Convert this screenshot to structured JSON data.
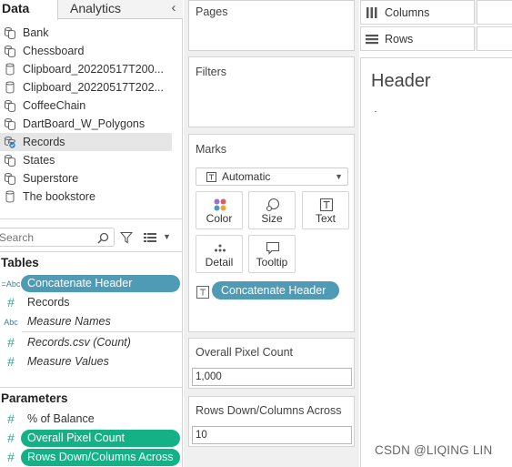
{
  "tabs": {
    "data": "Data",
    "analytics": "Analytics"
  },
  "datasources": [
    {
      "name": "Bank",
      "icon": "datasource-multi-icon"
    },
    {
      "name": "Chessboard",
      "icon": "datasource-multi-icon"
    },
    {
      "name": "Clipboard_20220517T200...",
      "icon": "datasource-cylinder-icon"
    },
    {
      "name": "Clipboard_20220517T202...",
      "icon": "datasource-cylinder-icon"
    },
    {
      "name": "CoffeeChain",
      "icon": "datasource-multi-icon"
    },
    {
      "name": "DartBoard_W_Polygons",
      "icon": "datasource-multi-icon"
    },
    {
      "name": "Records",
      "icon": "datasource-active-icon",
      "selected": true
    },
    {
      "name": "States",
      "icon": "datasource-multi-icon"
    },
    {
      "name": "Superstore",
      "icon": "datasource-multi-icon"
    },
    {
      "name": "The bookstore",
      "icon": "datasource-cylinder-icon"
    }
  ],
  "search": {
    "placeholder": "Search"
  },
  "tables": {
    "header": "Tables",
    "fields": [
      {
        "type": "=Abc",
        "name": "Concatenate Header",
        "pill": "blue"
      },
      {
        "type": "#",
        "name": "Records"
      },
      {
        "type": "Abc",
        "name": "Measure Names",
        "italic": true
      },
      {
        "type": "#",
        "name": "Records.csv (Count)",
        "italic": true
      },
      {
        "type": "#",
        "name": "Measure Values",
        "italic": true
      }
    ]
  },
  "parameters": {
    "header": "Parameters",
    "fields": [
      {
        "type": "#",
        "name": "% of Balance"
      },
      {
        "type": "#",
        "name": "Overall Pixel Count",
        "pill": "green"
      },
      {
        "type": "#",
        "name": "Rows Down/Columns Across",
        "pill": "green"
      }
    ]
  },
  "cards": {
    "pages": "Pages",
    "filters": "Filters",
    "marks": {
      "title": "Marks",
      "type": "Automatic",
      "buttons": [
        "Color",
        "Size",
        "Text",
        "Detail",
        "Tooltip"
      ],
      "pill": "Concatenate Header"
    },
    "param1": {
      "title": "Overall Pixel Count",
      "value": "1,000"
    },
    "param2": {
      "title": "Rows Down/Columns Across",
      "value": "10"
    }
  },
  "shelves": {
    "columns": "Columns",
    "rows": "Rows"
  },
  "view": {
    "header": "Header",
    "watermark": "CSDN @LIQING LIN"
  },
  "colors": {
    "dimension_pill": "#4f9bb5",
    "parameter_pill": "#14b086",
    "selected_row": "#e6e6e6"
  }
}
